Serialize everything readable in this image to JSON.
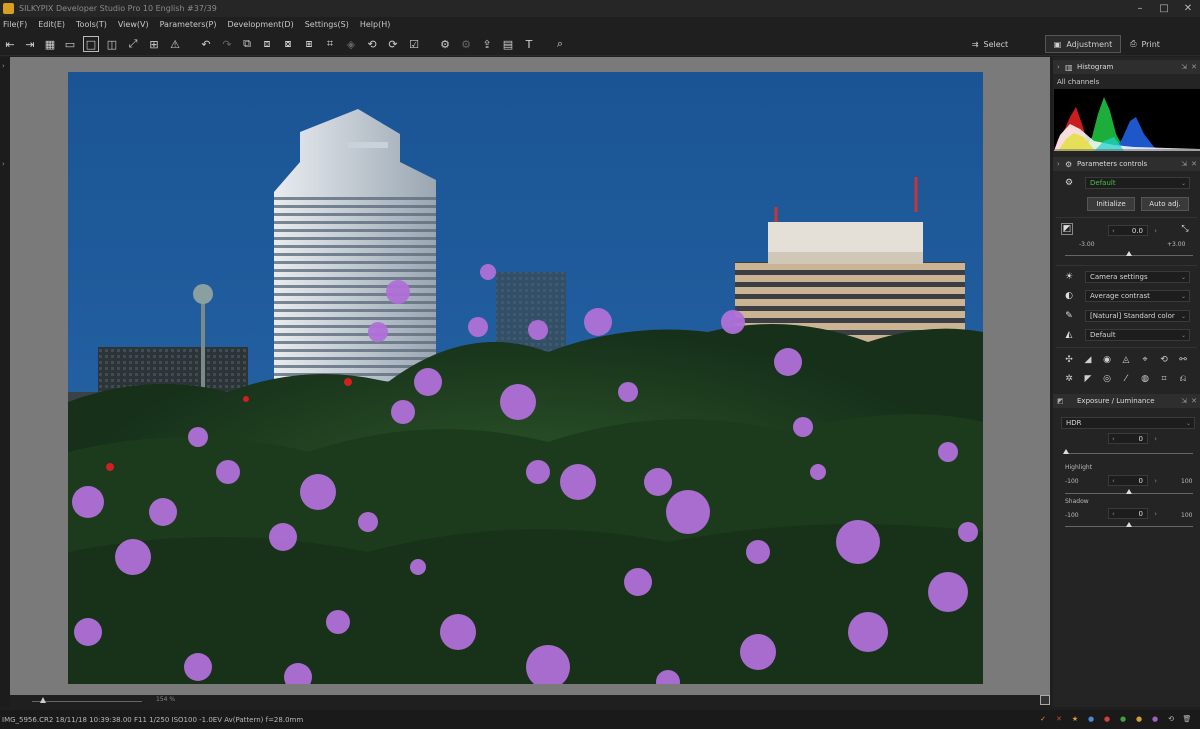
{
  "window": {
    "title": "SILKYPIX Developer Studio Pro 10 English   #37/39",
    "controls": [
      "minimize-icon",
      "maximize-icon",
      "close-icon"
    ]
  },
  "menu": [
    "File(F)",
    "Edit(E)",
    "Tools(T)",
    "View(V)",
    "Parameters(P)",
    "Development(D)",
    "Settings(S)",
    "Help(H)"
  ],
  "toolbar": {
    "modes": {
      "select": "Select",
      "adjustment": "Adjustment",
      "print": "Print"
    }
  },
  "viewer": {
    "zoom_label": "154",
    "zoom_unit": "%"
  },
  "status": {
    "text": "IMG_5956.CR2 18/11/18 10:39:38.00 F11 1/250 ISO100 -1.0EV Av(Pattern) f=28.0mm"
  },
  "panel": {
    "histogram": {
      "title": "Histogram",
      "channel": "All channels"
    },
    "params": {
      "title": "Parameters controls",
      "preset": "Default",
      "initialize": "Initialize",
      "auto_adj": "Auto adj.",
      "exposure_value": "0.0",
      "exposure_min": "-3.00",
      "exposure_max": "+3.00",
      "exposure_fraction": 0.5,
      "camera_settings": "Camera settings",
      "contrast": "Average contrast",
      "color": "[Natural] Standard color",
      "sharpness": "Default"
    },
    "exposure_luminance": {
      "title": "Exposure / Luminance",
      "hdr_label": "HDR",
      "hdr_value": "0",
      "highlight_label": "Highlight",
      "highlight_min": "-100",
      "highlight_max": "100",
      "highlight_value": "0",
      "shadow_label": "Shadow",
      "shadow_min": "-100",
      "shadow_max": "100",
      "shadow_value": "0"
    }
  },
  "colors": {
    "accent_green": "#48c048",
    "sky": "#1f5a98",
    "foliage": "#1e3a1a",
    "flower": "#b070d8"
  }
}
